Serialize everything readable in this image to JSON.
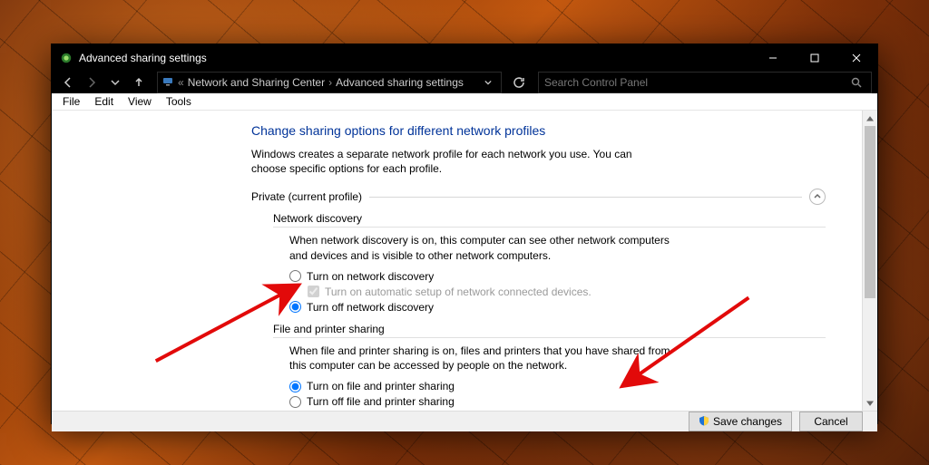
{
  "window": {
    "title": "Advanced sharing settings"
  },
  "nav": {
    "crumb1": "Network and Sharing Center",
    "crumb2": "Advanced sharing settings",
    "search_placeholder": "Search Control Panel"
  },
  "menu": {
    "file": "File",
    "edit": "Edit",
    "view": "View",
    "tools": "Tools"
  },
  "page": {
    "heading": "Change sharing options for different network profiles",
    "description": "Windows creates a separate network profile for each network you use. You can choose specific options for each profile.",
    "group_private": "Private (current profile)",
    "section_netdisc": {
      "title": "Network discovery",
      "desc": "When network discovery is on, this computer can see other network computers and devices and is visible to other network computers.",
      "opt_on": "Turn on network discovery",
      "opt_auto": "Turn on automatic setup of network connected devices.",
      "opt_off": "Turn off network discovery"
    },
    "section_fps": {
      "title": "File and printer sharing",
      "desc": "When file and printer sharing is on, files and printers that you have shared from this computer can be accessed by people on the network.",
      "opt_on": "Turn on file and printer sharing",
      "opt_off": "Turn off file and printer sharing"
    }
  },
  "footer": {
    "save": "Save changes",
    "cancel": "Cancel"
  }
}
